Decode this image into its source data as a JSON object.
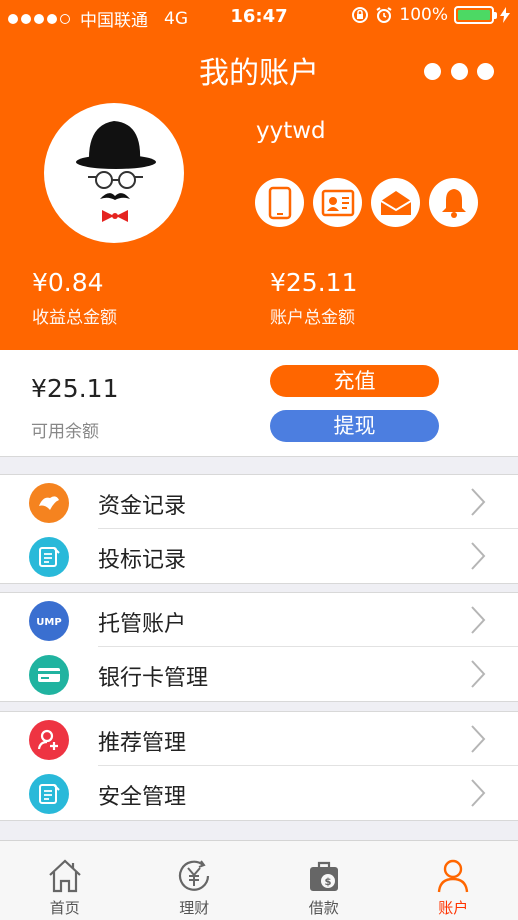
{
  "status_bar": {
    "carrier": "中国联通",
    "network": "4G",
    "time": "16:47",
    "battery": "100%"
  },
  "header": {
    "title": "我的账户",
    "username": "yytwd",
    "income_total_amount": "¥0.84",
    "income_total_label": "收益总金额",
    "account_total_amount": "¥25.11",
    "account_total_label": "账户总金额",
    "icons": [
      "phone-icon",
      "id-card-icon",
      "mail-icon",
      "bell-icon"
    ]
  },
  "balance": {
    "available_amount": "¥25.11",
    "available_label": "可用余额",
    "recharge_label": "充值",
    "withdraw_label": "提现"
  },
  "menu": {
    "group1": [
      {
        "label": "资金记录",
        "icon": "money-record-icon",
        "color": "#f5831f"
      },
      {
        "label": "投标记录",
        "icon": "bid-record-icon",
        "color": "#29b9d9"
      }
    ],
    "group2": [
      {
        "label": "托管账户",
        "icon": "ump-icon",
        "color": "#3a6fd0"
      },
      {
        "label": "银行卡管理",
        "icon": "bank-card-icon",
        "color": "#20b3a0"
      }
    ],
    "group3": [
      {
        "label": "推荐管理",
        "icon": "add-user-icon",
        "color": "#ee3442"
      },
      {
        "label": "安全管理",
        "icon": "security-icon",
        "color": "#29b9d9"
      }
    ]
  },
  "tabbar": {
    "tabs": [
      {
        "label": "首页",
        "icon": "home-icon"
      },
      {
        "label": "理财",
        "icon": "finance-icon"
      },
      {
        "label": "借款",
        "icon": "loan-icon"
      },
      {
        "label": "账户",
        "icon": "account-icon",
        "active": true
      }
    ]
  },
  "colors": {
    "primary": "#ff6600",
    "withdraw": "#4c7ee0",
    "active_tab": "#ff3300"
  }
}
